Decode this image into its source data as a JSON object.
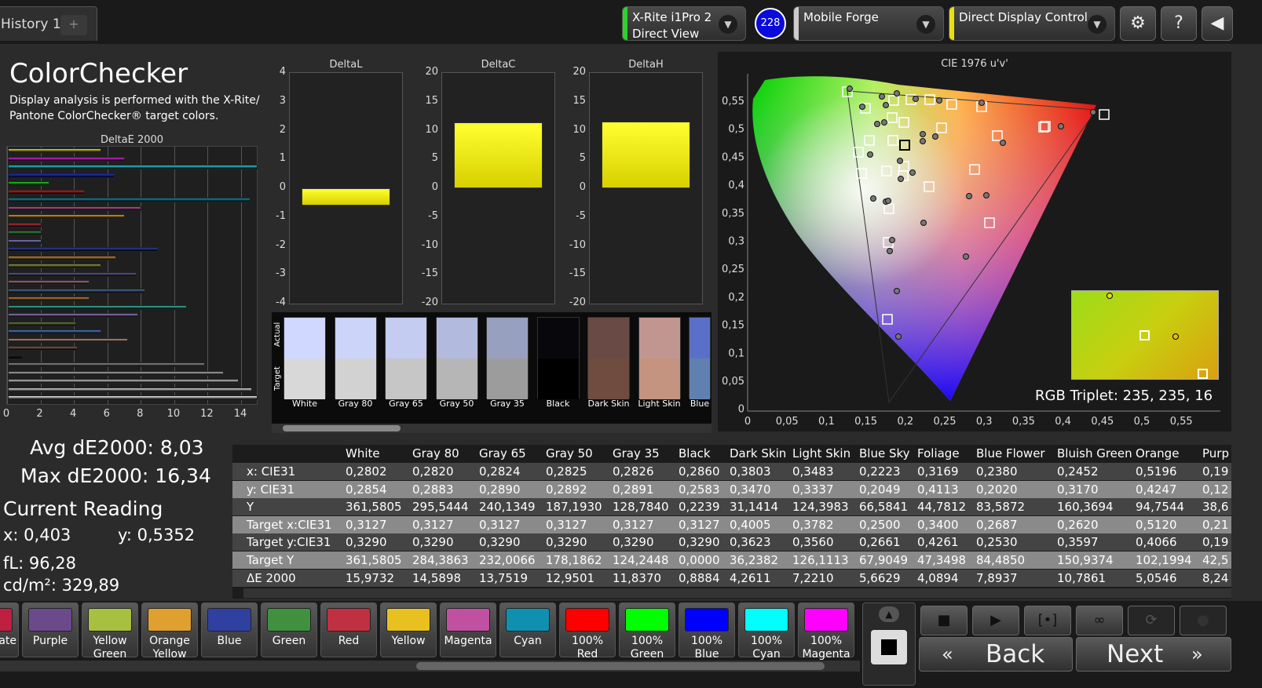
{
  "tabs": {
    "history": "History 1",
    "add": "+"
  },
  "device1": {
    "line1": "X-Rite i1Pro 2",
    "line2": "Direct View",
    "color": "#2ed12e"
  },
  "badge": "228",
  "device2": {
    "line1": "Mobile Forge",
    "color": "#cccccc"
  },
  "device3": {
    "line1": "Direct Display Control",
    "color": "#e8e010"
  },
  "icons": {
    "settings": "gear-icon",
    "help": "question-icon",
    "collapse": "arrow-left-icon",
    "dropdown": "chevron-down-icon"
  },
  "help_label": "?",
  "title": "ColorChecker",
  "description": "Display analysis is performed with the X-Rite/ Pantone ColorChecker® target colors.",
  "deltae_chart": {
    "title": "DeltaE 2000",
    "xticks": [
      "0",
      "2",
      "4",
      "6",
      "8",
      "10",
      "12",
      "14"
    ],
    "xmax": 15,
    "bars": [
      {
        "value": 5.6,
        "color": "#e6df20"
      },
      {
        "value": 7.0,
        "color": "#e020e0"
      },
      {
        "value": 15.2,
        "color": "#20d8e0"
      },
      {
        "value": 6.4,
        "color": "#2030d0"
      },
      {
        "value": 2.5,
        "color": "#20d020"
      },
      {
        "value": 4.6,
        "color": "#d02020"
      },
      {
        "value": 14.5,
        "color": "#1090a8"
      },
      {
        "value": 8.0,
        "color": "#c050a0"
      },
      {
        "value": 7.0,
        "color": "#e0a020"
      },
      {
        "value": 2.0,
        "color": "#c03040"
      },
      {
        "value": 2.0,
        "color": "#3c9040"
      },
      {
        "value": 2.0,
        "color": "#8080c0"
      },
      {
        "value": 9.0,
        "color": "#3040a0"
      },
      {
        "value": 6.5,
        "color": "#d09030"
      },
      {
        "value": 5.6,
        "color": "#90a040"
      },
      {
        "value": 7.7,
        "color": "#6058a0"
      },
      {
        "value": 4.9,
        "color": "#b07080"
      },
      {
        "value": 8.2,
        "color": "#5070a0"
      },
      {
        "value": 4.9,
        "color": "#d08030"
      },
      {
        "value": 10.7,
        "color": "#40b0a0"
      },
      {
        "value": 7.8,
        "color": "#9080c0"
      },
      {
        "value": 4.1,
        "color": "#708040"
      },
      {
        "value": 5.6,
        "color": "#5080c0"
      },
      {
        "value": 7.2,
        "color": "#c09080"
      },
      {
        "value": 4.2,
        "color": "#806050"
      },
      {
        "value": 0.9,
        "color": "#202020"
      },
      {
        "value": 11.8,
        "color": "#909090"
      },
      {
        "value": 12.9,
        "color": "#b0b0b0"
      },
      {
        "value": 13.8,
        "color": "#c8c8c8"
      },
      {
        "value": 14.6,
        "color": "#e0e0e0"
      },
      {
        "value": 16.0,
        "color": "#f4f4f4"
      }
    ]
  },
  "stats": {
    "avg": "Avg dE2000: 8,03",
    "max": "Max dE2000: 16,34"
  },
  "reading": {
    "title": "Current Reading",
    "x": "x: 0,403",
    "y": "y: 0,5352",
    "fl": "fL: 96,28",
    "cdm": "cd/m²: 329,89"
  },
  "delta_panels": [
    {
      "title": "DeltaL",
      "ticks": [
        "4",
        "3",
        "2",
        "1",
        "0",
        "-1",
        "-2",
        "-3",
        "-4"
      ],
      "min": -4,
      "max": 4,
      "value": -0.6
    },
    {
      "title": "DeltaC",
      "ticks": [
        "20",
        "15",
        "10",
        "5",
        "0",
        "-5",
        "-10",
        "-15",
        "-20"
      ],
      "min": -20,
      "max": 20,
      "value": 11.4
    },
    {
      "title": "DeltaH",
      "ticks": [
        "20",
        "15",
        "10",
        "5",
        "0",
        "-5",
        "-10",
        "-15",
        "-20"
      ],
      "min": -20,
      "max": 20,
      "value": 11.6
    }
  ],
  "swatches": {
    "actual_label": "Actual",
    "target_label": "Target",
    "items": [
      {
        "label": "White",
        "actual": "#d0d8ff",
        "target": "#d8d8d8"
      },
      {
        "label": "Gray 80",
        "actual": "#ccd4fa",
        "target": "#d2d2d2"
      },
      {
        "label": "Gray 65",
        "actual": "#c4ccf2",
        "target": "#c6c6c6"
      },
      {
        "label": "Gray 50",
        "actual": "#b2bade",
        "target": "#b6b6b6"
      },
      {
        "label": "Gray 35",
        "actual": "#98a0c0",
        "target": "#9c9c9c"
      },
      {
        "label": "Black",
        "actual": "#08080c",
        "target": "#000000"
      },
      {
        "label": "Dark Skin",
        "actual": "#6a4a44",
        "target": "#704c40"
      },
      {
        "label": "Light Skin",
        "actual": "#c29690",
        "target": "#c49480"
      },
      {
        "label": "Blue",
        "actual": "#5a70c8",
        "target": "#6080b0"
      }
    ]
  },
  "cie_chart": {
    "title": "CIE 1976 u'v'",
    "xticks": [
      "0",
      "0,05",
      "0,1",
      "0,15",
      "0,2",
      "0,25",
      "0,3",
      "0,35",
      "0,4",
      "0,45",
      "0,5",
      "0,55"
    ],
    "yticks": [
      "0,55",
      "0,5",
      "0,45",
      "0,4",
      "0,35",
      "0,3",
      "0,25",
      "0,2",
      "0,15",
      "0,1",
      "0,05",
      "0"
    ],
    "rgb_triplet": "RGB Triplet: 235, 235, 16"
  },
  "table": {
    "columns": [
      "",
      "White",
      "Gray 80",
      "Gray 65",
      "Gray 50",
      "Gray 35",
      "Black",
      "Dark Skin",
      "Light Skin",
      "Blue Sky",
      "Foliage",
      "Blue Flower",
      "Bluish Green",
      "Orange",
      "Purp"
    ],
    "rows": [
      [
        "x: CIE31",
        "0,2802",
        "0,2820",
        "0,2824",
        "0,2825",
        "0,2826",
        "0,2860",
        "0,3803",
        "0,3483",
        "0,2223",
        "0,3169",
        "0,2380",
        "0,2452",
        "0,5196",
        "0,19"
      ],
      [
        "y: CIE31",
        "0,2854",
        "0,2883",
        "0,2890",
        "0,2892",
        "0,2891",
        "0,2583",
        "0,3470",
        "0,3337",
        "0,2049",
        "0,4113",
        "0,2020",
        "0,3170",
        "0,4247",
        "0,12"
      ],
      [
        "Y",
        "361,5805",
        "295,5444",
        "240,1349",
        "187,1930",
        "128,7840",
        "0,2239",
        "31,1414",
        "124,3983",
        "66,5841",
        "44,7812",
        "83,5872",
        "160,3694",
        "94,7544",
        "38,6"
      ],
      [
        "Target x:CIE31",
        "0,3127",
        "0,3127",
        "0,3127",
        "0,3127",
        "0,3127",
        "0,3127",
        "0,4005",
        "0,3782",
        "0,2500",
        "0,3400",
        "0,2687",
        "0,2620",
        "0,5120",
        "0,21"
      ],
      [
        "Target y:CIE31",
        "0,3290",
        "0,3290",
        "0,3290",
        "0,3290",
        "0,3290",
        "0,3290",
        "0,3623",
        "0,3560",
        "0,2661",
        "0,4261",
        "0,2530",
        "0,3597",
        "0,4066",
        "0,19"
      ],
      [
        "Target Y",
        "361,5805",
        "284,3863",
        "232,0066",
        "178,1862",
        "124,2448",
        "0,0000",
        "36,2382",
        "126,1113",
        "67,9049",
        "47,3498",
        "84,4850",
        "150,9374",
        "102,1994",
        "42,5"
      ],
      [
        "ΔE 2000",
        "15,9732",
        "14,5898",
        "13,7519",
        "12,9501",
        "11,8370",
        "0,8884",
        "4,2611",
        "7,2210",
        "5,6629",
        "4,0894",
        "7,8937",
        "10,7861",
        "5,0546",
        "8,24"
      ]
    ]
  },
  "patches": [
    {
      "label": "ate",
      "color": "#c02040"
    },
    {
      "label": "Purple",
      "color": "#6a4a8a"
    },
    {
      "label": "Yellow Green",
      "color": "#a8c040"
    },
    {
      "label": "Orange Yellow",
      "color": "#e0a030"
    },
    {
      "label": "Blue",
      "color": "#3040a0"
    },
    {
      "label": "Green",
      "color": "#409040"
    },
    {
      "label": "Red",
      "color": "#c03040"
    },
    {
      "label": "Yellow",
      "color": "#e8c020"
    },
    {
      "label": "Magenta",
      "color": "#c050a0"
    },
    {
      "label": "Cyan",
      "color": "#1090b0"
    },
    {
      "label": "100% Red",
      "color": "#ff0000"
    },
    {
      "label": "100% Green",
      "color": "#00ff00"
    },
    {
      "label": "100% Blue",
      "color": "#0000ff"
    },
    {
      "label": "100% Cyan",
      "color": "#00ffff"
    },
    {
      "label": "100% Magenta",
      "color": "#ff00ff"
    }
  ],
  "nav": {
    "back": "Back",
    "next": "Next",
    "back_icon": "«",
    "next_icon": "»"
  }
}
